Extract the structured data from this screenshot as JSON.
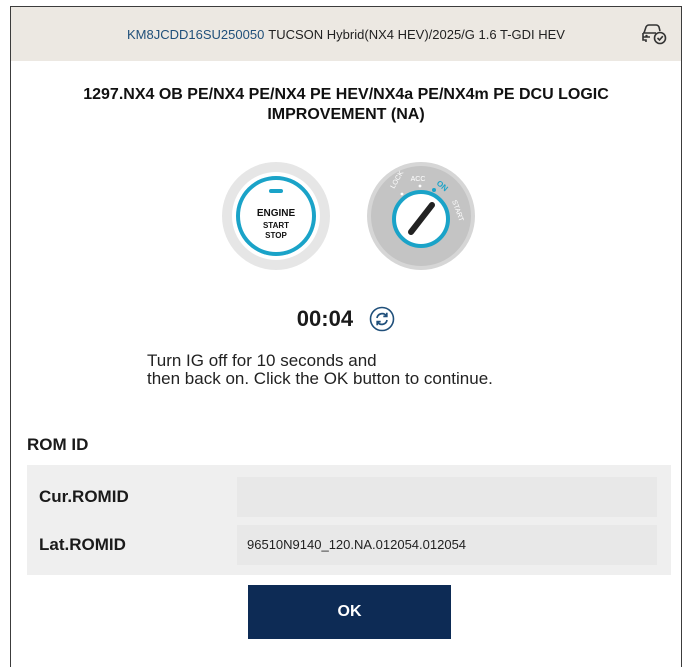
{
  "header": {
    "vin": "KM8JCDD16SU250050",
    "vehicle": "TUCSON Hybrid(NX4 HEV)/2025/G 1.6 T-GDI HEV",
    "vehicle_icon": "car-check-icon"
  },
  "title": "1297.NX4 OB PE/NX4 PE/NX4 PE HEV/NX4a PE/NX4m PE DCU LOGIC IMPROVEMENT (NA)",
  "engine_button": {
    "line1": "ENGINE",
    "line2": "START",
    "line3": "STOP"
  },
  "ignition_key": {
    "lock": "LOCK",
    "acc": "ACC",
    "on": "ON",
    "start": "START",
    "active_color": "#1aa3c8"
  },
  "timer": {
    "value": "00:04",
    "refresh_icon": "refresh-icon"
  },
  "instruction": {
    "line1": "Turn IG off for 10 seconds and",
    "line2": "then back on. Click the OK button to continue."
  },
  "rom": {
    "section_label": "ROM ID",
    "rows": [
      {
        "label": "Cur.ROMID",
        "value": ""
      },
      {
        "label": "Lat.ROMID",
        "value": "96510N9140_120.NA.012054.012054"
      }
    ]
  },
  "ok_button": {
    "label": "OK",
    "color": "#0d2b55"
  }
}
